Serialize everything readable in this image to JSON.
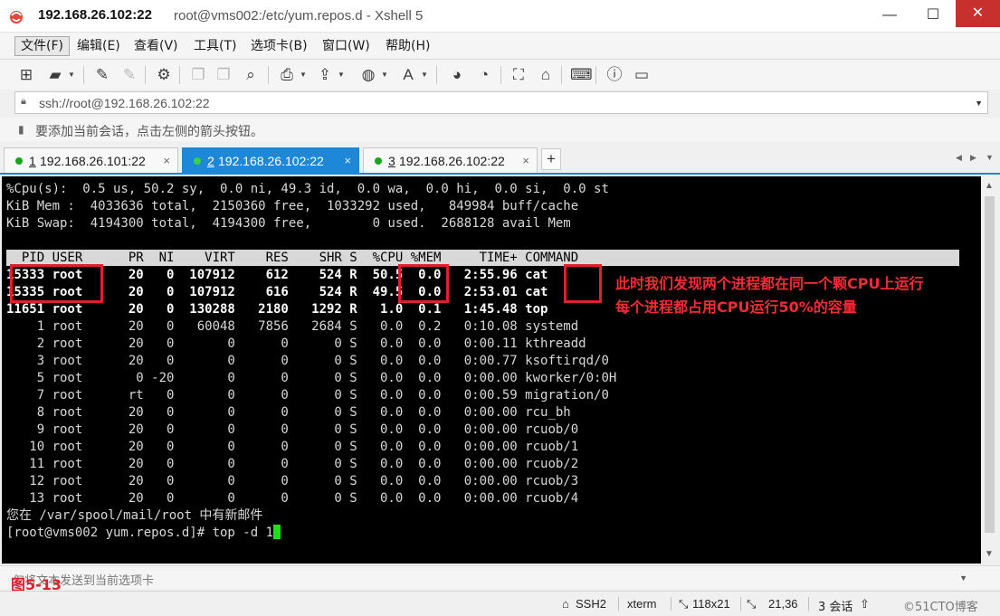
{
  "window": {
    "title_host": "192.168.26.102:22",
    "title_rest": "root@vms002:/etc/yum.repos.d - Xshell 5",
    "minimize": "—",
    "maximize": "☐",
    "close": "✕"
  },
  "menu": [
    "文件(F)",
    "编辑(E)",
    "查看(V)",
    "工具(T)",
    "选项卡(B)",
    "窗口(W)",
    "帮助(H)"
  ],
  "toolbar": {
    "icons": [
      "new-session-icon",
      "open-folder-icon",
      "connect-icon",
      "disconnect-icon",
      "properties-icon",
      "copy-icon",
      "paste-icon",
      "find-icon",
      "print-icon",
      "transfer-icon",
      "globe-icon",
      "font-icon",
      "xftp-icon",
      "xmanager-icon",
      "fullscreen-icon",
      "lock-icon",
      "keyboard-icon",
      "help-icon",
      "chat-icon"
    ]
  },
  "address": {
    "value": "ssh://root@192.168.26.102:22"
  },
  "hint": {
    "text": "要添加当前会话，点击左侧的箭头按钮。"
  },
  "tabs": [
    {
      "num": "1",
      "label": "192.168.26.101:22",
      "active": false
    },
    {
      "num": "2",
      "label": "192.168.26.102:22",
      "active": true
    },
    {
      "num": "3",
      "label": "192.168.26.102:22",
      "active": false
    }
  ],
  "tab_add": "+",
  "terminal": {
    "cpu_line": "%Cpu(s):  0.5 us, 50.2 sy,  0.0 ni, 49.3 id,  0.0 wa,  0.0 hi,  0.0 si,  0.0 st",
    "mem_line": "KiB Mem :  4033636 total,  2150360 free,  1033292 used,   849984 buff/cache",
    "swap_line": "KiB Swap:  4194300 total,  4194300 free,        0 used.  2688128 avail Mem",
    "header": "  PID USER      PR  NI    VIRT    RES    SHR S  %CPU %MEM     TIME+ COMMAND",
    "rows": [
      "15333 root      20   0  107912    612    524 R  50.5  0.0   2:55.96 cat",
      "15335 root      20   0  107912    616    524 R  49.5  0.0   2:53.01 cat",
      "11651 root      20   0  130288   2180   1292 R   1.0  0.1   1:45.48 top",
      "    1 root      20   0   60048   7856   2684 S   0.0  0.2   0:10.08 systemd",
      "    2 root      20   0       0      0      0 S   0.0  0.0   0:00.11 kthreadd",
      "    3 root      20   0       0      0      0 S   0.0  0.0   0:00.77 ksoftirqd/0",
      "    5 root       0 -20       0      0      0 S   0.0  0.0   0:00.00 kworker/0:0H",
      "    7 root      rt   0       0      0      0 S   0.0  0.0   0:00.59 migration/0",
      "    8 root      20   0       0      0      0 S   0.0  0.0   0:00.00 rcu_bh",
      "    9 root      20   0       0      0      0 S   0.0  0.0   0:00.00 rcuob/0",
      "   10 root      20   0       0      0      0 S   0.0  0.0   0:00.00 rcuob/1",
      "   11 root      20   0       0      0      0 S   0.0  0.0   0:00.00 rcuob/2",
      "   12 root      20   0       0      0      0 S   0.0  0.0   0:00.00 rcuob/3",
      "   13 root      20   0       0      0      0 S   0.0  0.0   0:00.00 rcuob/4"
    ],
    "mail_line": "您在 /var/spool/mail/root 中有新邮件",
    "prompt": "[root@vms002 yum.repos.d]# top -d 1"
  },
  "annotation": {
    "line1": "此时我们发现两个进程都在同一个颗CPU上运行",
    "line2": "每个进程都占用CPU运行50%的容量",
    "color": "#f22c36"
  },
  "compose": {
    "placeholder": "仅将文本发送到当前选项卡"
  },
  "figure_label": "图5-13",
  "status": {
    "protocol": "SSH2",
    "term": "xterm",
    "size": "118x21",
    "cursor_pos": "21,36",
    "sessions": "3 会话",
    "watermark": "©51CTO博客"
  },
  "colors": {
    "accent": "#1e88d8",
    "highlight": "#e0202c",
    "cursor": "#1ee01e"
  }
}
